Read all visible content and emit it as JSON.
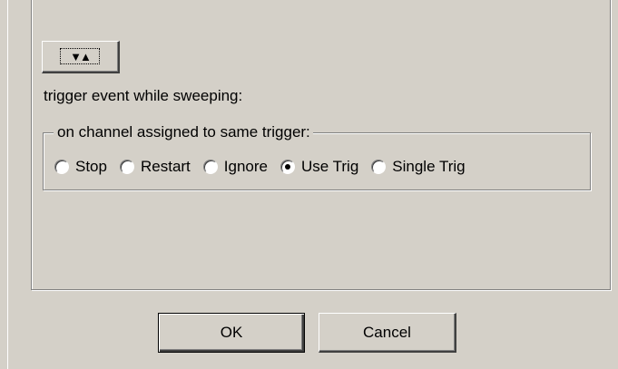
{
  "dialog": {
    "toggle_button": {
      "icon": "down-up-triangles-icon",
      "glyph": "▼▲"
    },
    "trigger_label": "trigger event while sweeping:",
    "group": {
      "legend": "on channel assigned to same trigger:",
      "options": [
        {
          "label": "Stop",
          "checked": false
        },
        {
          "label": "Restart",
          "checked": false
        },
        {
          "label": "Ignore",
          "checked": false
        },
        {
          "label": "Use Trig",
          "checked": true
        },
        {
          "label": "Single Trig",
          "checked": false
        }
      ]
    },
    "buttons": {
      "ok_label": "OK",
      "cancel_label": "Cancel"
    }
  }
}
